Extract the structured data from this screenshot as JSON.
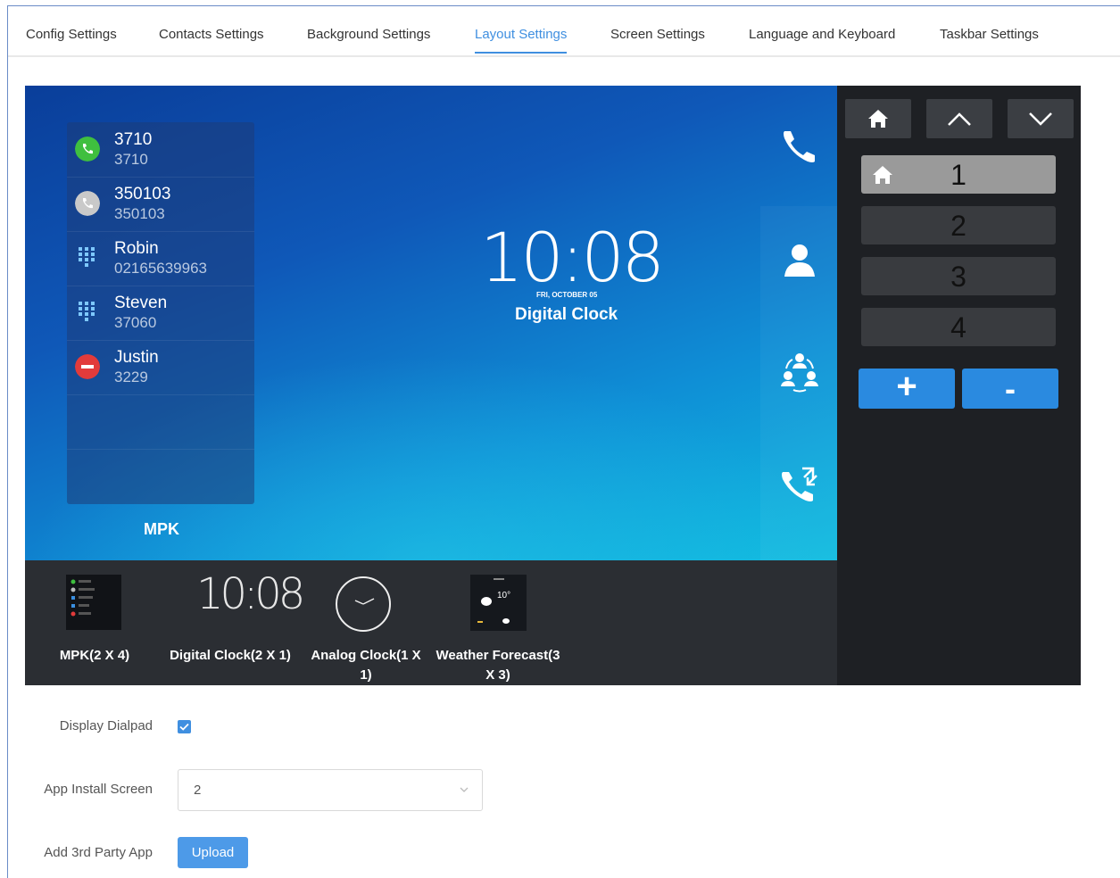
{
  "tabs": [
    {
      "label": "Config Settings"
    },
    {
      "label": "Contacts Settings"
    },
    {
      "label": "Background Settings"
    },
    {
      "label": "Layout Settings",
      "active": true
    },
    {
      "label": "Screen Settings"
    },
    {
      "label": "Language and Keyboard"
    },
    {
      "label": "Taskbar Settings"
    }
  ],
  "preview": {
    "mpk": {
      "label": "MPK",
      "contacts": [
        {
          "name": "3710",
          "number": "3710",
          "status": "online",
          "icon": "green-phone-icon"
        },
        {
          "name": "350103",
          "number": "350103",
          "status": "idle",
          "icon": "gray-phone-icon"
        },
        {
          "name": "Robin",
          "number": "02165639963",
          "status": "contact",
          "icon": "dialpad-icon"
        },
        {
          "name": "Steven",
          "number": "37060",
          "status": "contact",
          "icon": "dialpad-icon"
        },
        {
          "name": "Justin",
          "number": "3229",
          "status": "busy",
          "icon": "red-busy-icon"
        }
      ]
    },
    "clock": {
      "time": "10:08",
      "date": "FRI, OCTOBER 05",
      "label": "Digital Clock"
    },
    "side_icons": [
      "phone-icon",
      "contact-icon",
      "conference-icon",
      "call-transfer-icon"
    ]
  },
  "widgets": [
    {
      "label": "MPK(2 X 4)"
    },
    {
      "label": "Digital Clock(2 X 1)",
      "thumb_time": "10:08"
    },
    {
      "label": "Analog Clock(1 X 1)"
    },
    {
      "label": "Weather Forecast(3 X 3)",
      "thumb_temp": "10°"
    }
  ],
  "pages": {
    "items": [
      "1",
      "2",
      "3",
      "4"
    ],
    "selected": "1",
    "plus_label": "+",
    "minus_label": "-"
  },
  "form": {
    "display_dialpad_label": "Display Dialpad",
    "display_dialpad_checked": true,
    "app_install_label": "App Install Screen",
    "app_install_value": "2",
    "third_party_label": "Add 3rd Party App",
    "upload_label": "Upload"
  },
  "colors": {
    "accent": "#3f8fe0",
    "preview_top": "#0a3e9a",
    "preview_bottom": "#11bde0",
    "page_panel": "#1e2024",
    "add_button": "#2a8ae0"
  }
}
